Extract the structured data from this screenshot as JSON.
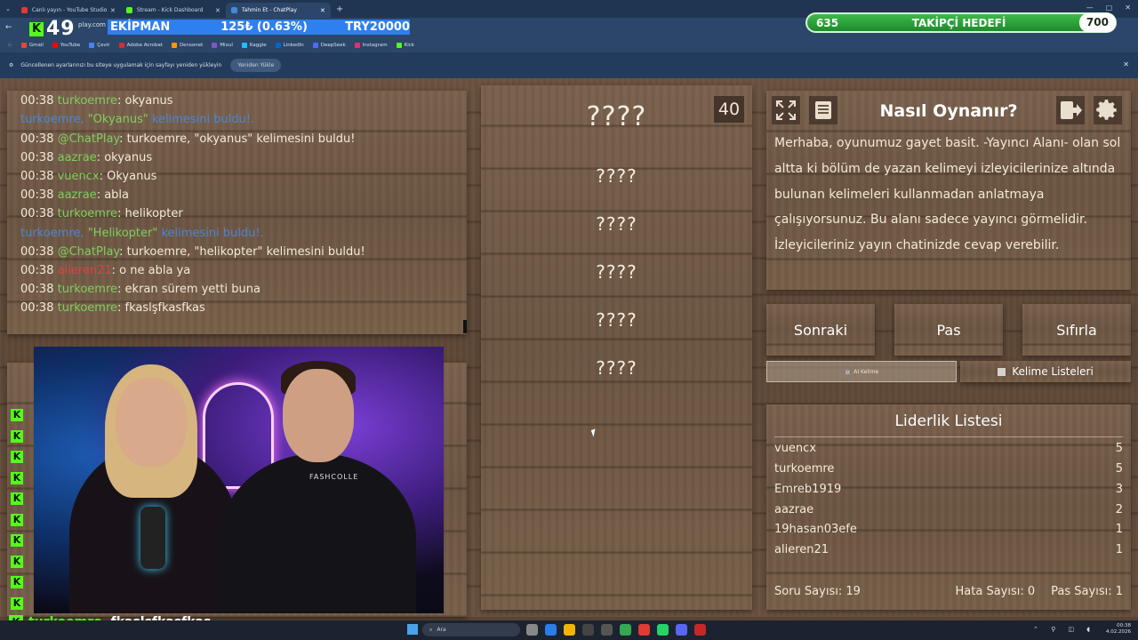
{
  "browser": {
    "tabs": [
      {
        "title": "Canlı yayın - YouTube Studio",
        "color": "#e53935"
      },
      {
        "title": "Stream - Kick Dashboard",
        "color": "#53fc18"
      },
      {
        "title": "Tahmin Et - ChatPlay",
        "color": "#4a86d8"
      }
    ],
    "url_fragment": "play.com",
    "bookmarks": [
      "Gmail",
      "YouTube",
      "Çevir",
      "Adobe Acrobat",
      "Densonet",
      "Mixul",
      "Kaggle",
      "LinkedIn",
      "DeepSeek",
      "Instagram",
      "Kick"
    ],
    "infobar_text": "Güncellenen ayarlarınızı bu siteye uygulamak için sayfayı yeniden yükleyin",
    "infobar_button": "Yeniden Yükle"
  },
  "overlay": {
    "kick_count": "49",
    "ticker_items": [
      "EKİPMAN",
      "125₺ (0.63%)",
      "TRY20000"
    ],
    "goal": {
      "current": "635",
      "label": "TAKİPÇİ HEDEFİ",
      "target": "700"
    }
  },
  "chat": {
    "messages": [
      {
        "time": "00:38",
        "user": "turkoemre",
        "text": ": okyanus",
        "type": "msg"
      },
      {
        "time": "",
        "user": "turkoemre, ",
        "highlight": "\"Okyanus\"",
        "text": " kelimesini buldu!.",
        "type": "sys"
      },
      {
        "time": "00:38",
        "user": "@ChatPlay",
        "text": ": turkoemre, \"okyanus\" kelimesini buldu!",
        "type": "msg"
      },
      {
        "time": "00:38",
        "user": "aazrae",
        "text": ": okyanus",
        "type": "msg"
      },
      {
        "time": "00:38",
        "user": "vuencx",
        "text": ": Okyanus",
        "type": "msg"
      },
      {
        "time": "00:38",
        "user": "aazrae",
        "text": ": abla",
        "type": "msg"
      },
      {
        "time": "00:38",
        "user": "turkoemre",
        "text": ": helikopter",
        "type": "msg"
      },
      {
        "time": "",
        "user": "turkoemre, ",
        "highlight": "\"Helikopter\"",
        "text": " kelimesini buldu!.",
        "type": "sys"
      },
      {
        "time": "00:38",
        "user": "@ChatPlay",
        "text": ": turkoemre, \"helikopter\" kelimesini buldu!",
        "type": "msg"
      },
      {
        "time": "00:38",
        "user": "alieren21",
        "text": ": o ne abla ya",
        "type": "msg-red"
      },
      {
        "time": "00:38",
        "user": "turkoemre",
        "text": ": ekran sürem yetti buna",
        "type": "msg"
      },
      {
        "time": "00:38",
        "user": "turkoemre",
        "text": ": fkaslşfkasfkas",
        "type": "msg"
      }
    ]
  },
  "game": {
    "timer": "40",
    "words": [
      "????",
      "????",
      "????",
      "????",
      "????",
      "????"
    ],
    "how_to": {
      "title": "Nasıl Oynanır?",
      "text": "Merhaba, oyunumuz gayet basit. -Yayıncı Alanı- olan sol altta ki bölüm de yazan kelimeyi izleyicilerinize altında bulunan kelimeleri kullanmadan anlatmaya çalışıyorsunuz. Bu alanı sadece yayıncı görmelidir. İzleyicileriniz yayın chatinizde cevap verebilir."
    },
    "buttons": {
      "next": "Sonraki",
      "pass": "Pas",
      "reset": "Sıfırla",
      "ai_word": "AI Kelime",
      "word_lists": "Kelime Listeleri"
    },
    "leaderboard": {
      "title": "Liderlik Listesi",
      "rows": [
        {
          "name": "vuencx",
          "score": "5"
        },
        {
          "name": "turkoemre",
          "score": "5"
        },
        {
          "name": "Emreb1919",
          "score": "3"
        },
        {
          "name": "aazrae",
          "score": "2"
        },
        {
          "name": "19hasan03efe",
          "score": "1"
        },
        {
          "name": "alieren21",
          "score": "1"
        }
      ],
      "question_count": "Soru Sayısı: 19",
      "error_count": "Hata Sayısı: 0",
      "pass_count": "Pas Sayısı: 1"
    }
  },
  "webcam": {
    "brand_text": "FASHCOLLE"
  },
  "bottom_chat": {
    "user": "turkoemre",
    "text": "fkaslşfkasfkas"
  },
  "taskbar": {
    "search_placeholder": "Ara",
    "time": "00:38",
    "date": "4.02.2026"
  }
}
